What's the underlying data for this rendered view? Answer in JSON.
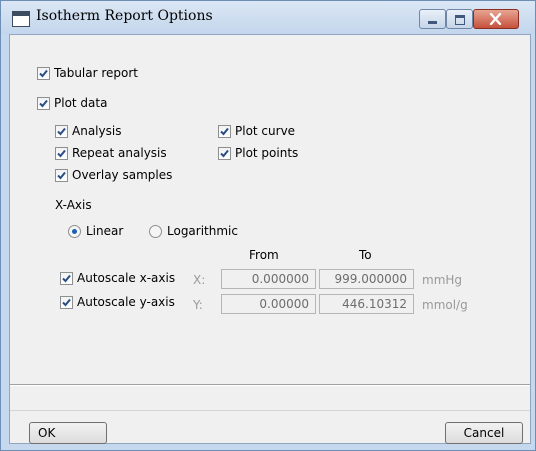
{
  "window": {
    "title": "Isotherm Report Options",
    "icon": "app-window-icon",
    "controls": [
      "minimize-icon",
      "maximize-icon",
      "close-icon"
    ]
  },
  "options": {
    "tabular_report": {
      "label": "Tabular report",
      "checked": true
    },
    "plot_data": {
      "label": "Plot data",
      "checked": true
    },
    "analysis": {
      "label": "Analysis",
      "checked": true
    },
    "repeat_analysis": {
      "label": "Repeat analysis",
      "checked": true
    },
    "overlay_samples": {
      "label": "Overlay samples",
      "checked": true
    },
    "plot_curve": {
      "label": "Plot curve",
      "checked": true
    },
    "plot_points": {
      "label": "Plot points",
      "checked": true
    }
  },
  "x_axis": {
    "heading": "X-Axis",
    "linear_label": "Linear",
    "logarithmic_label": "Logarithmic",
    "selected": "Linear"
  },
  "scaling": {
    "from_header": "From",
    "to_header": "To",
    "x_row": {
      "label": "Autoscale x-axis",
      "checked": true,
      "axis_letter": "X:",
      "from": "0.000000",
      "to": "999.000000",
      "unit": "mmHg"
    },
    "y_row": {
      "label": "Autoscale y-axis",
      "checked": true,
      "axis_letter": "Y:",
      "from": "0.00000",
      "to": "446.10312",
      "unit": "mmol/g"
    }
  },
  "buttons": {
    "ok": "OK",
    "cancel": "Cancel"
  },
  "colors": {
    "title_bar": "#c3d6ec",
    "close_button": "#c6513c",
    "check_mark": "#2a4d86",
    "radio_selected": "#1a5fb4"
  }
}
